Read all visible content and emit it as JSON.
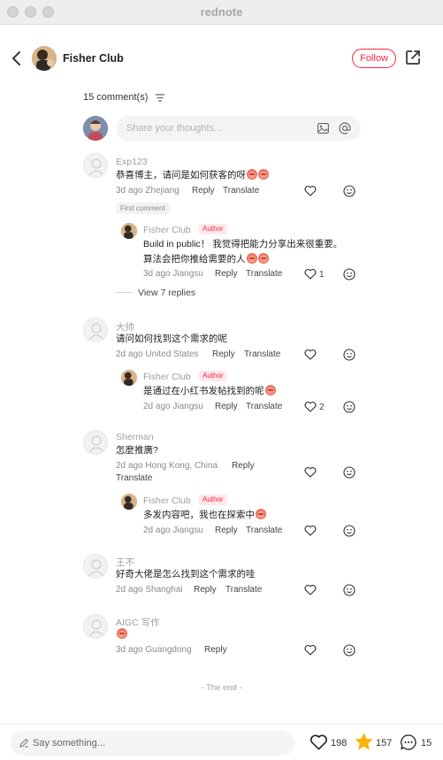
{
  "window": {
    "title": "rednote"
  },
  "header": {
    "author": "Fisher Club",
    "follow_label": "Follow"
  },
  "comments_header": {
    "count_label": "15 comment(s)"
  },
  "composer": {
    "placeholder": "Share your thoughts..."
  },
  "labels": {
    "reply": "Reply",
    "translate": "Translate",
    "author_badge": "Author",
    "first_comment": "First comment"
  },
  "comments": [
    {
      "user": "Exp123",
      "text": "恭喜博主，请问是如何获客的呀",
      "meta": "3d ago Zhejiang",
      "reply": {
        "user": "Fisher Club",
        "text_line1": "Build in public！ 我觉得把能力分享出来很重要。",
        "text_line2": "算法会把你推给需要的人",
        "meta": "3d ago Jiangsu",
        "likes": "1"
      },
      "view_replies": "View 7 replies"
    },
    {
      "user": "大帅",
      "text": "请问如何找到这个需求的呢",
      "meta": "2d ago United States",
      "reply": {
        "user": "Fisher Club",
        "text": "是通过在小红书发帖找到的呢",
        "meta": "2d ago Jiangsu",
        "likes": "2"
      }
    },
    {
      "user": "Sherman",
      "text": "怎麼推廣?",
      "meta": "2d ago Hong Kong, China",
      "reply": {
        "user": "Fisher Club",
        "text": "多发内容吧，我也在探索中",
        "meta": "2d ago Jiangsu"
      }
    },
    {
      "user": "王不",
      "text": "好奇大佬是怎么找到这个需求的哇",
      "meta": "2d ago Shanghai"
    },
    {
      "user": "AIGC 写作",
      "meta": "3d ago Guangdong"
    }
  ],
  "end_label": "- The end -",
  "bottom_bar": {
    "placeholder": "Say something...",
    "likes": "198",
    "stars": "157",
    "comments": "15"
  },
  "colors": {
    "accent": "#ff2442",
    "star": "#f7b500"
  }
}
